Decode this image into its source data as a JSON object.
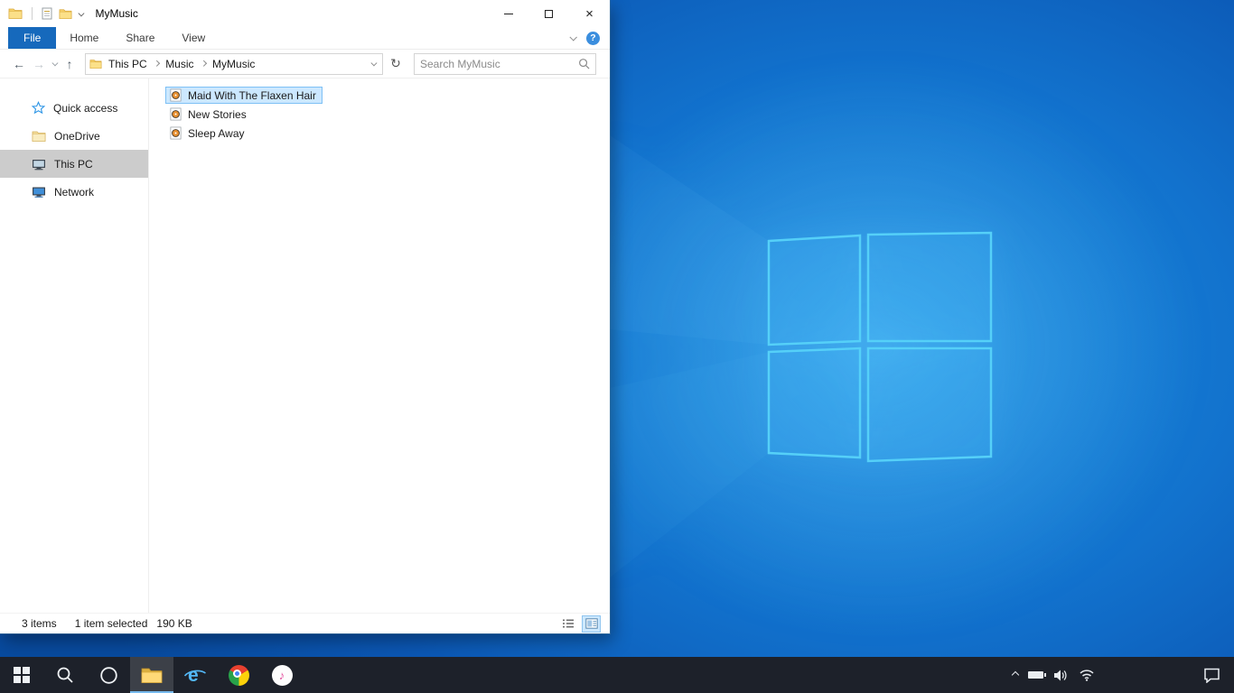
{
  "window": {
    "title": "MyMusic",
    "ribbon": {
      "tabs": [
        "File",
        "Home",
        "Share",
        "View"
      ]
    },
    "nav": {
      "breadcrumb": [
        "This PC",
        "Music",
        "MyMusic"
      ],
      "search_placeholder": "Search MyMusic"
    },
    "sidebar": {
      "items": [
        "Quick access",
        "OneDrive",
        "This PC",
        "Network"
      ],
      "selected_item": "This PC"
    },
    "files": {
      "items": [
        "Maid With The Flaxen Hair",
        "New Stories",
        "Sleep Away"
      ],
      "selected_item": "Maid With The Flaxen Hair"
    },
    "statusbar": {
      "count": "3 items",
      "selection": "1 item selected",
      "size": "190 KB"
    }
  },
  "taskbar": {
    "apps": [
      "start",
      "search",
      "cortana",
      "file-explorer",
      "internet-explorer",
      "chrome",
      "itunes"
    ],
    "active_app": "file-explorer",
    "tray_icons": [
      "hidden-icons-chevron",
      "battery",
      "volume",
      "network",
      "action-center"
    ]
  },
  "colors": {
    "accent": "#0078d7",
    "file_tab_bg": "#1669bc",
    "selection_bg": "#cce8ff",
    "selection_border": "#7ec0f5",
    "sidebar_selected_bg": "#cccccc",
    "taskbar_bg": "#1d212a",
    "wallpaper_blue": "#1272cd",
    "logo_stroke": "#55d0f8"
  }
}
